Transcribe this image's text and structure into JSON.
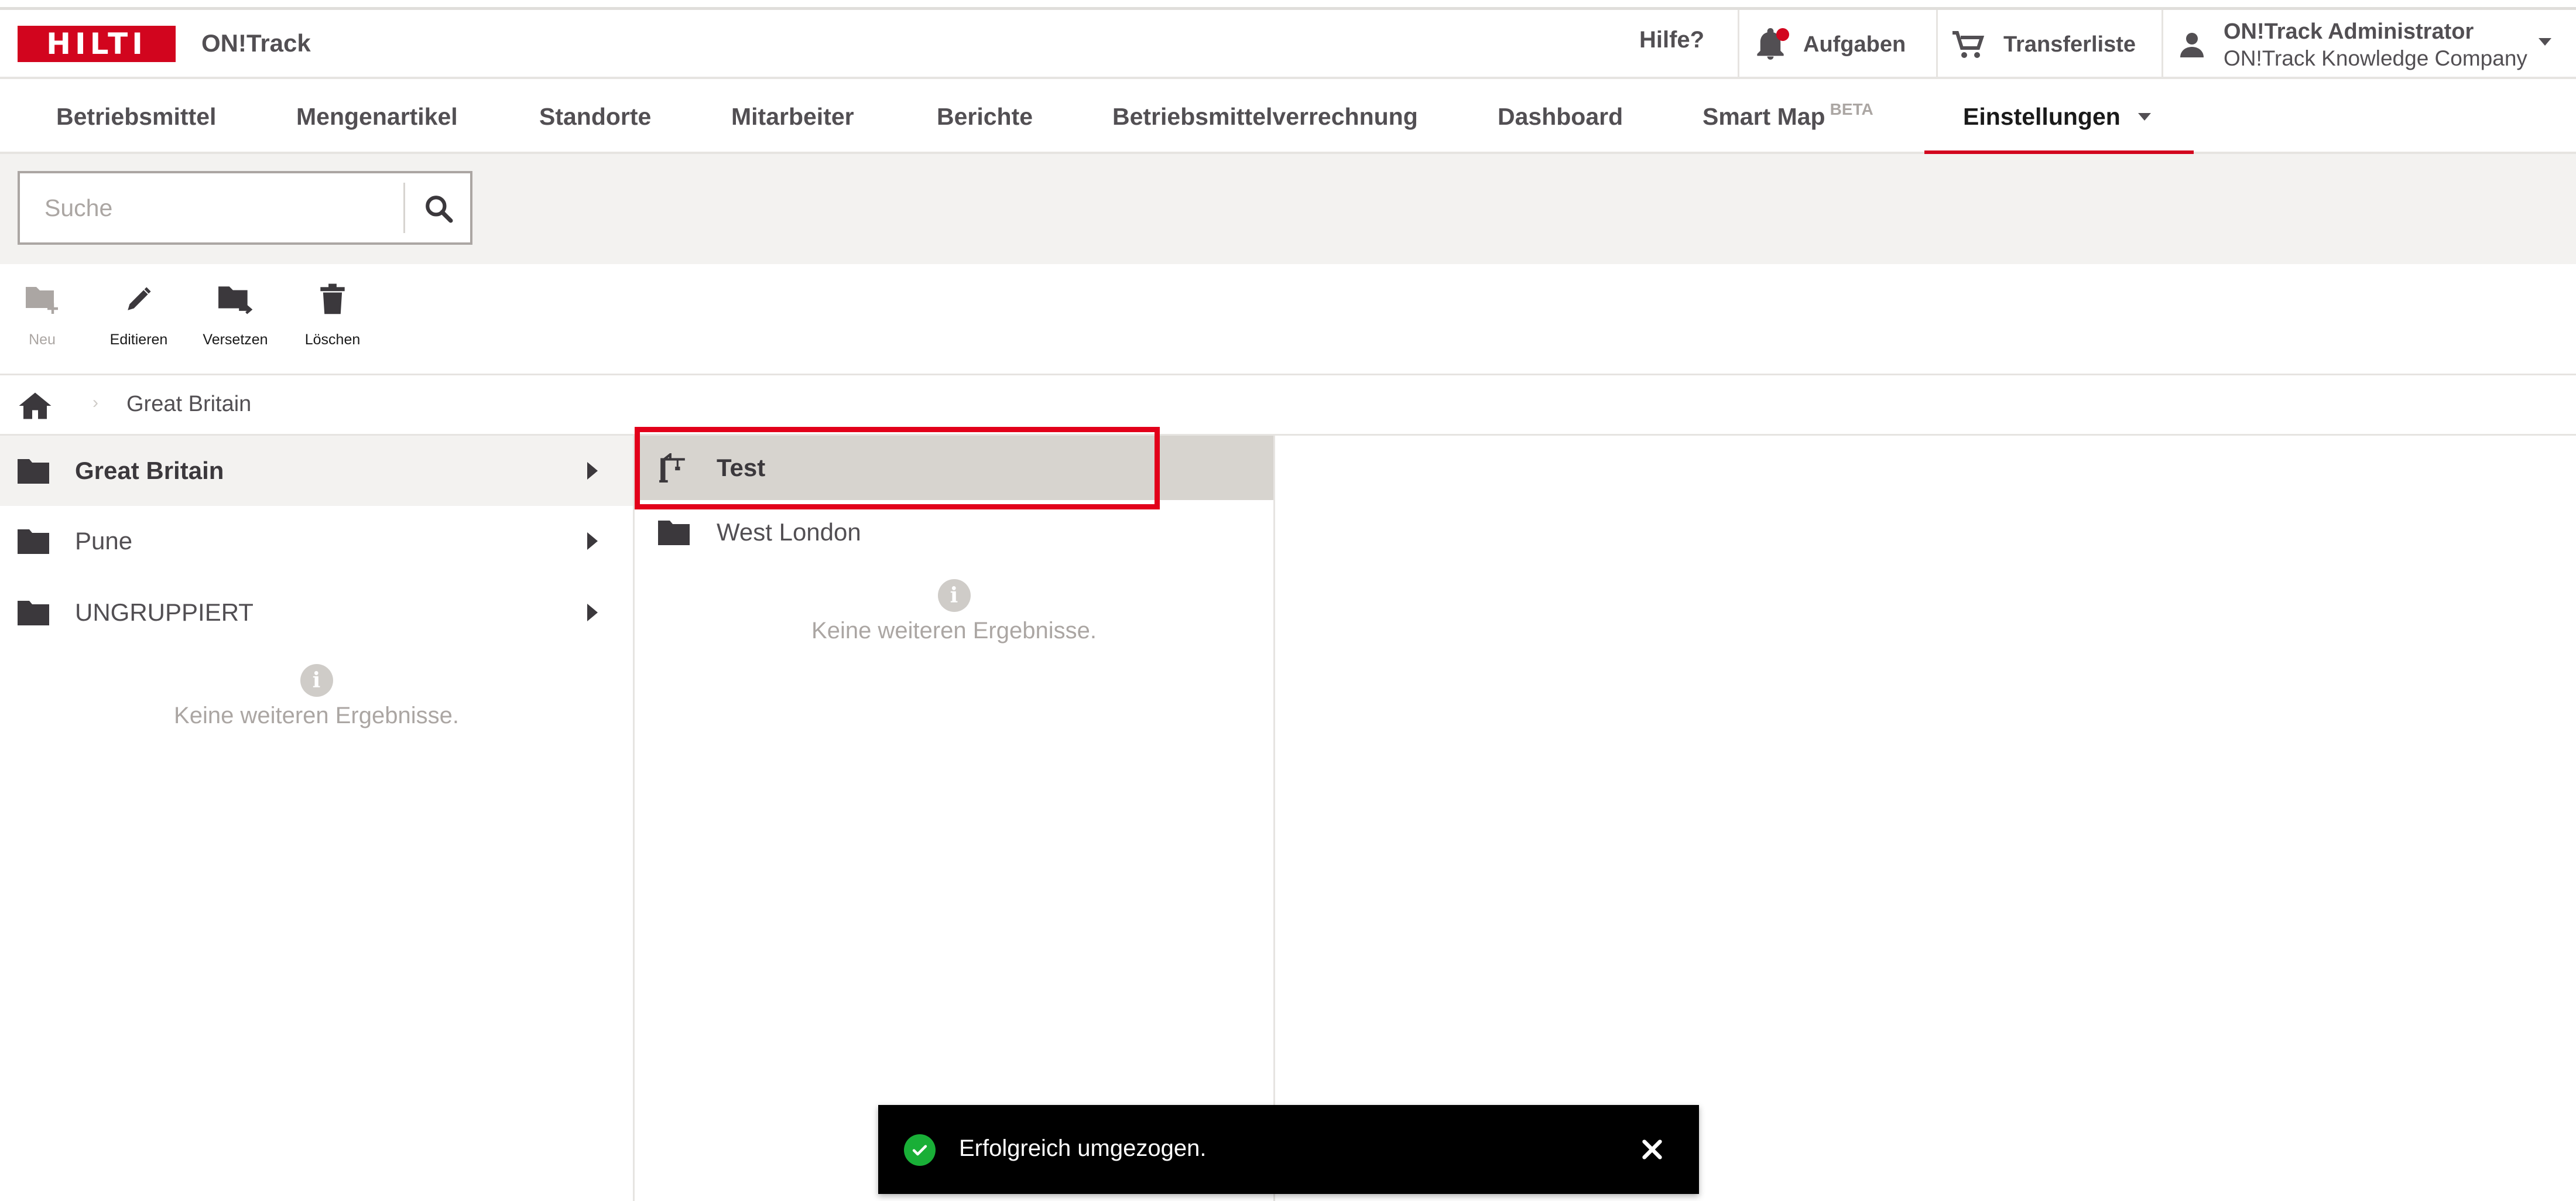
{
  "app": {
    "brand": "HILTI",
    "name": "ON!Track",
    "brand_color": "#d2051e"
  },
  "header": {
    "help": "Hilfe?",
    "tasks": "Aufgaben",
    "transfer": "Transferliste",
    "user_name": "ON!Track Administrator",
    "user_company": "ON!Track Knowledge Company"
  },
  "nav": {
    "tabs": [
      {
        "label": "Betriebsmittel"
      },
      {
        "label": "Mengenartikel"
      },
      {
        "label": "Standorte"
      },
      {
        "label": "Mitarbeiter"
      },
      {
        "label": "Berichte"
      },
      {
        "label": "Betriebsmittelverrechnung"
      },
      {
        "label": "Dashboard"
      },
      {
        "label": "Smart Map",
        "badge": "BETA"
      },
      {
        "label": "Einstellungen",
        "active": true
      }
    ]
  },
  "search": {
    "placeholder": "Suche",
    "value": ""
  },
  "toolbar": {
    "new": "Neu",
    "edit": "Editieren",
    "move": "Versetzen",
    "delete": "Löschen"
  },
  "breadcrumb": {
    "items": [
      "Great Britain"
    ]
  },
  "column1": {
    "items": [
      {
        "label": "Great Britain",
        "icon": "folder-icon",
        "selected": true
      },
      {
        "label": "Pune",
        "icon": "folder-icon"
      },
      {
        "label": "UNGRUPPIERT",
        "icon": "folder-icon"
      }
    ],
    "no_results": "Keine weiteren Ergebnisse."
  },
  "column2": {
    "items": [
      {
        "label": "Test",
        "icon": "crane-icon",
        "highlighted": true
      },
      {
        "label": "West London",
        "icon": "folder-icon"
      }
    ],
    "no_results": "Keine weiteren Ergebnisse."
  },
  "toast": {
    "message": "Erfolgreich umgezogen.",
    "status_color": "#19af37"
  }
}
